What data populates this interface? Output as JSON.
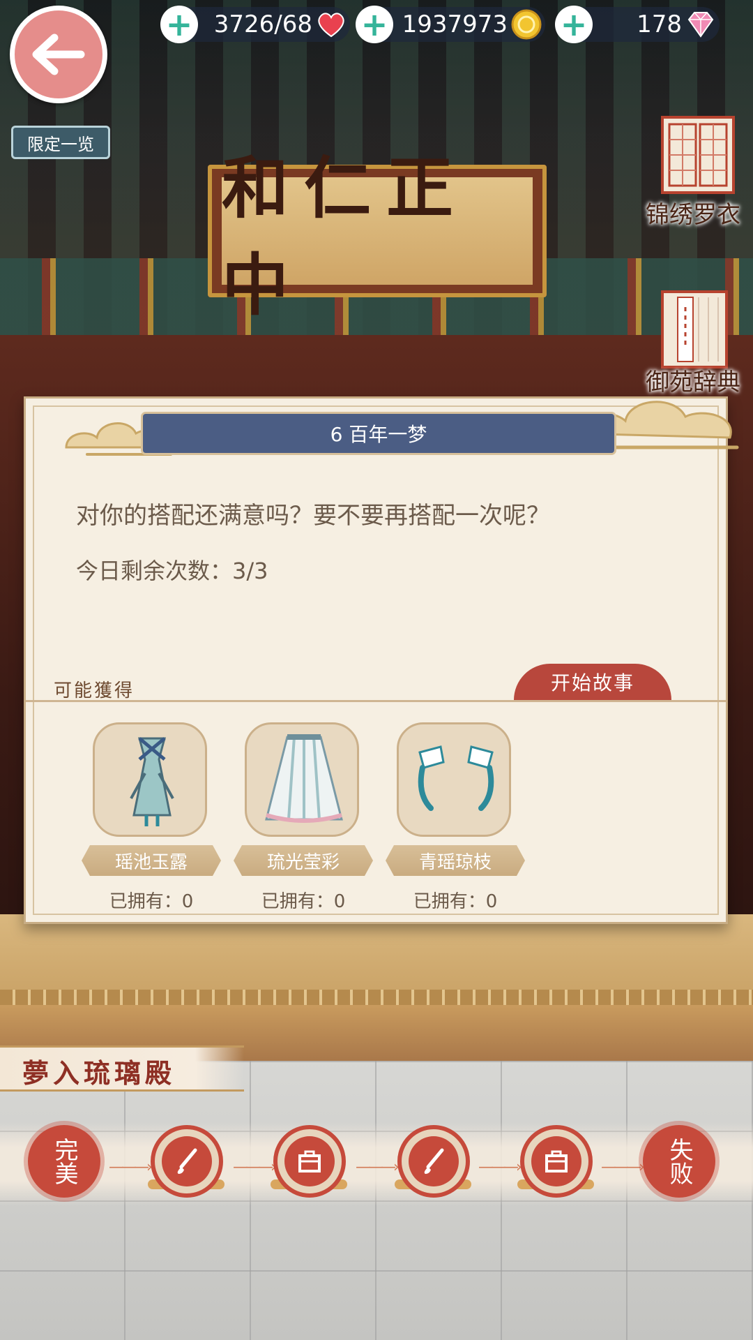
{
  "top_bar": {
    "stamina_value": "3726/68",
    "gold_value": "1937973",
    "diamond_value": "178",
    "icons": {
      "stamina": "heart-icon",
      "gold": "gold-coin-icon",
      "diamond": "pink-diamond-icon",
      "add": "plus-icon",
      "back": "back-arrow-icon"
    }
  },
  "limited_label": "限定一览",
  "plaque_text": "和仁正中",
  "side_menu": {
    "wardrobe_label": "锦绣罗衣",
    "dictionary_label": "御苑辞典"
  },
  "dialog": {
    "title": "6 百年一梦",
    "message": "对你的搭配还满意吗？要不要再搭配一次呢？",
    "remaining": "今日剩余次数：3/3",
    "possible_label": "可能獲得",
    "start_button": "开始故事",
    "rewards": [
      {
        "name": "瑶池玉露",
        "owned": "已拥有：0",
        "icon": "dress-outfit-icon"
      },
      {
        "name": "琉光莹彩",
        "owned": "已拥有：0",
        "icon": "skirt-icon"
      },
      {
        "name": "青瑶琼枝",
        "owned": "已拥有：0",
        "icon": "sleeve-accessory-icon"
      }
    ]
  },
  "chapter": {
    "name": "夢入琉璃殿",
    "start_node": "完美",
    "end_node": "失败",
    "steps": [
      "brush-icon",
      "chest-icon",
      "brush-icon",
      "chest-icon"
    ]
  },
  "colors": {
    "accent_red": "#c64a3b",
    "header_blue": "#4b5d84",
    "panel": "#f6efe2",
    "back_pink": "#e58d8b"
  }
}
